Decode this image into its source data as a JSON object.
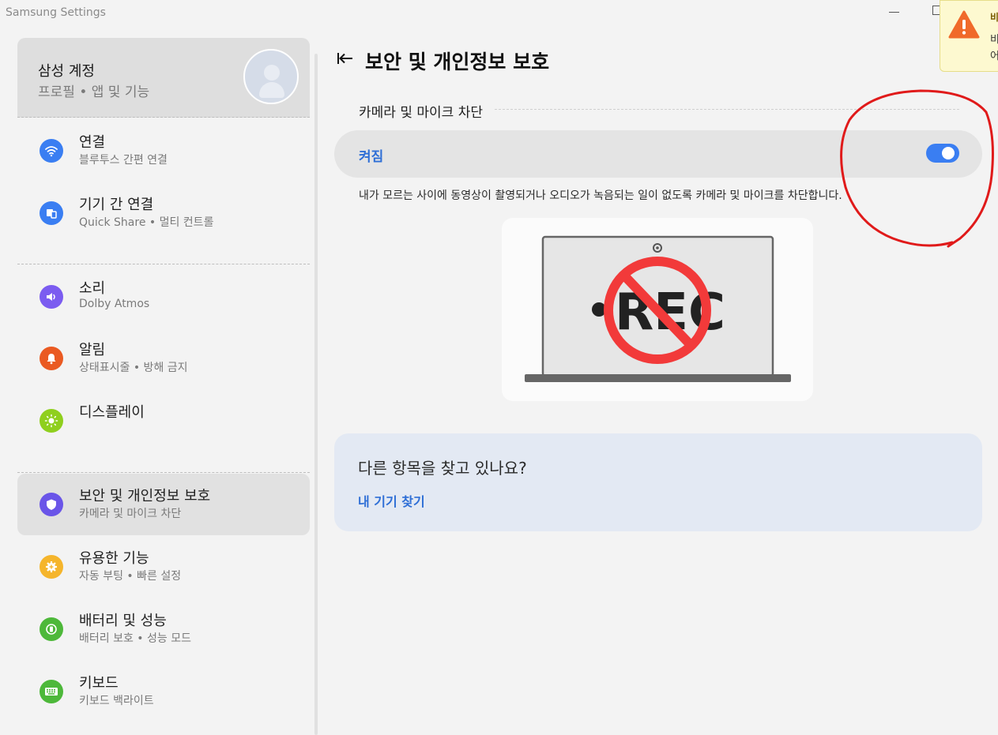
{
  "window": {
    "title": "Samsung Settings"
  },
  "toast": {
    "title": "비",
    "line1": "비",
    "line2": "어"
  },
  "sidebar": {
    "account": {
      "title": "삼성 계정",
      "subtitle": "프로필 • 앱 및 기능"
    },
    "items": [
      {
        "title": "연결",
        "subtitle": "블루투스 간편 연결",
        "icon": "wifi-icon",
        "color": "#3a7ef2"
      },
      {
        "title": "기기 간 연결",
        "subtitle": "Quick Share  •  멀티 컨트롤",
        "icon": "devices-icon",
        "color": "#3a7ef2"
      },
      {
        "title": "소리",
        "subtitle": "Dolby Atmos",
        "icon": "speaker-icon",
        "color": "#7b5cf0"
      },
      {
        "title": "알림",
        "subtitle": "상태표시줄 • 방해 금지",
        "icon": "bell-icon",
        "color": "#ea5a22"
      },
      {
        "title": "디스플레이",
        "subtitle": "",
        "icon": "brightness-icon",
        "color": "#8fcf1e"
      },
      {
        "title": "보안 및 개인정보 보호",
        "subtitle": "카메라 및 마이크 차단",
        "icon": "shield-icon",
        "color": "#6a55e8"
      },
      {
        "title": "유용한 기능",
        "subtitle": "자동 부팅  •  빠른 설정",
        "icon": "gear-plus-icon",
        "color": "#f5b52c"
      },
      {
        "title": "배터리 및 성능",
        "subtitle": "배터리 보호  •  성능 모드",
        "icon": "battery-icon",
        "color": "#4db83a"
      },
      {
        "title": "키보드",
        "subtitle": "키보드 백라이트",
        "icon": "keyboard-icon",
        "color": "#4db83a"
      }
    ]
  },
  "main": {
    "page_title": "보안 및 개인정보 보호",
    "section_title": "카메라 및 마이크 차단",
    "toggle": {
      "label": "켜짐",
      "state": "on"
    },
    "description": "내가 모르는 사이에 동영상이 촬영되거나 오디오가 녹음되는 일이 없도록 카메라 및 마이크를 차단합니다.",
    "illustration_text": "REC",
    "help": {
      "title": "다른 항목을 찾고 있나요?",
      "link": "내 기기 찾기"
    }
  },
  "colors": {
    "accent": "#3a7ef2",
    "link": "#2f6fd6",
    "annotation": "#e01a1a",
    "prohibit": "#f23a3a"
  }
}
